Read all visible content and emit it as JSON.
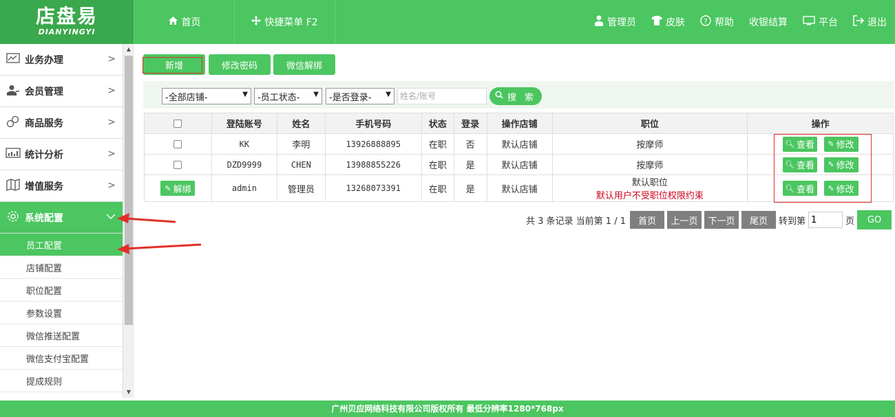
{
  "logo": {
    "cn": "店盘易",
    "en": "DIANYINGYI"
  },
  "header": {
    "left": [
      {
        "icon": "home-icon",
        "label": "首页"
      },
      {
        "icon": "move-icon",
        "label": "快捷菜单 F2"
      }
    ],
    "right": [
      {
        "icon": "user-icon",
        "label": "管理员"
      },
      {
        "icon": "shirt-icon",
        "label": "皮肤"
      },
      {
        "icon": "help-icon",
        "label": "帮助"
      },
      {
        "icon": "",
        "label": "收银结算"
      },
      {
        "icon": "monitor-icon",
        "label": "平台"
      },
      {
        "icon": "logout-icon",
        "label": "退出"
      }
    ]
  },
  "sidebar": {
    "groups": [
      {
        "icon": "chart-icon",
        "label": "业务办理"
      },
      {
        "icon": "member-icon",
        "label": "会员管理"
      },
      {
        "icon": "link-icon",
        "label": "商品服务"
      },
      {
        "icon": "stats-icon",
        "label": "统计分析"
      },
      {
        "icon": "map-icon",
        "label": "增值服务"
      },
      {
        "icon": "gear-icon",
        "label": "系统配置"
      }
    ],
    "sub_items": [
      "员工配置",
      "店铺配置",
      "职位配置",
      "参数设置",
      "微信推送配置",
      "微信支付宝配置",
      "提成规则"
    ]
  },
  "toolbar": {
    "add": "新增",
    "change_pwd": "修改密码",
    "wx_unbind": "微信解绑"
  },
  "filters": {
    "shop": "-全部店铺-",
    "status": "-员工状态-",
    "login": "-是否登录-",
    "name_placeholder": "姓名/账号",
    "search": "搜 索"
  },
  "table": {
    "headers": [
      "登陆账号",
      "姓名",
      "手机号码",
      "状态",
      "登录",
      "操作店铺",
      "职位",
      "操作"
    ],
    "rows": [
      {
        "account": "KK",
        "name": "李明",
        "phone": "13926888895",
        "status": "在职",
        "login": "否",
        "shop": "默认店铺",
        "position": "按摩师",
        "note": ""
      },
      {
        "account": "DZD9999",
        "name": "CHEN",
        "phone": "13988855226",
        "status": "在职",
        "login": "是",
        "shop": "默认店铺",
        "position": "按摩师",
        "note": ""
      },
      {
        "account": "admin",
        "name": "管理员",
        "phone": "13268073391",
        "status": "在职",
        "login": "是",
        "shop": "默认店铺",
        "position": "默认职位",
        "note": "默认用户不受职位权限约束"
      }
    ],
    "view_label": "查看",
    "edit_label": "修改",
    "unbind_label": "解绑"
  },
  "pager": {
    "summary": "共 3 条记录 当前第 1 / 1",
    "first": "首页",
    "prev": "上一页",
    "next": "下一页",
    "last": "尾页",
    "goto_label": "转到第",
    "goto_value": "1",
    "page_unit": "页",
    "go": "GO"
  },
  "footer": {
    "text": "广州贝应网络科技有限公司版权所有 最低分辨率1280*768px"
  },
  "colors": {
    "brand_green": "#4bc660",
    "accent_red": "#e0302a"
  }
}
